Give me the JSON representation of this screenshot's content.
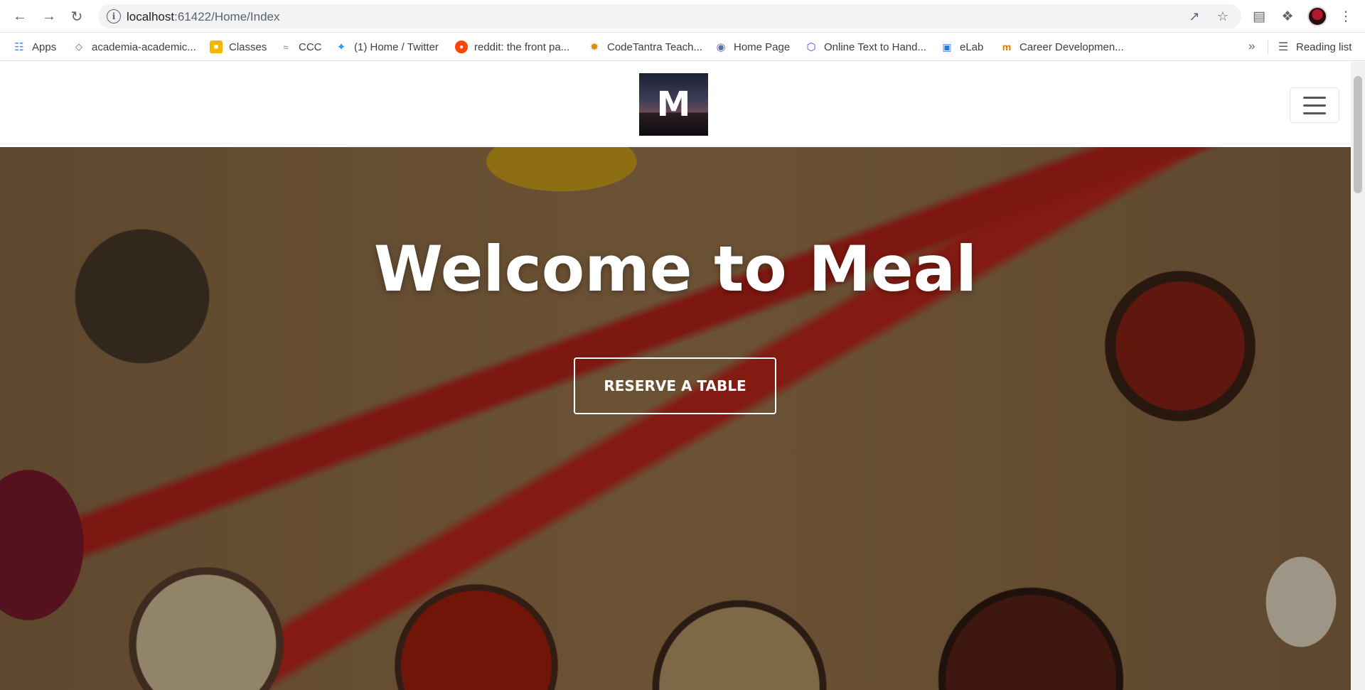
{
  "browser": {
    "url_host": "localhost",
    "url_rest": ":61422/Home/Index",
    "reading_list": "Reading list",
    "overflow": "»"
  },
  "bookmarks": [
    {
      "label": "Apps",
      "icon": "apps-grid-icon"
    },
    {
      "label": "academia-academic...",
      "icon": "academia-icon"
    },
    {
      "label": "Classes",
      "icon": "google-classroom-icon"
    },
    {
      "label": "CCC",
      "icon": "ccc-icon"
    },
    {
      "label": "(1) Home / Twitter",
      "icon": "twitter-icon"
    },
    {
      "label": "reddit: the front pa...",
      "icon": "reddit-icon"
    },
    {
      "label": "CodeTantra Teach...",
      "icon": "codetantra-icon"
    },
    {
      "label": "Home Page",
      "icon": "home-page-icon"
    },
    {
      "label": "Online Text to Hand...",
      "icon": "online-text-icon"
    },
    {
      "label": "eLab",
      "icon": "elab-icon"
    },
    {
      "label": "Career Developmen...",
      "icon": "career-icon"
    }
  ],
  "site": {
    "logo_letter": "M",
    "hero_title": "Welcome to Meal",
    "reserve_button": "RESERVE A TABLE"
  },
  "colors": {
    "twitter": "#1d9bf0",
    "reddit": "#ff4500",
    "classroom": "#f4b400"
  }
}
